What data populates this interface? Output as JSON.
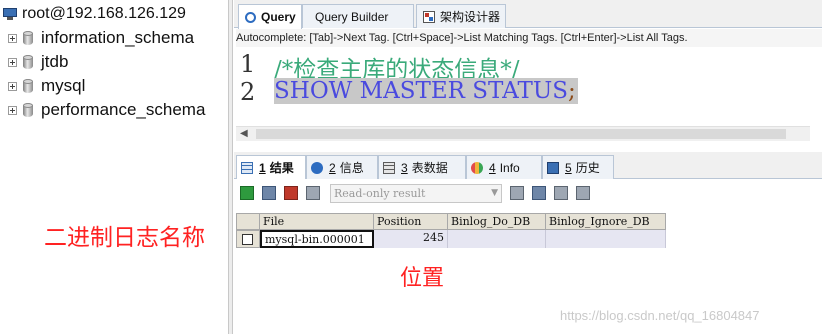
{
  "tree": {
    "root": "root@192.168.126.129",
    "databases": [
      "information_schema",
      "jtdb",
      "mysql",
      "performance_schema"
    ]
  },
  "query_tabs": [
    {
      "label": "Query",
      "icon": "search-icon",
      "active": true
    },
    {
      "label": "Query Builder",
      "icon": "query-builder-icon",
      "active": false
    },
    {
      "label": "架构设计器",
      "icon": "schema-designer-icon",
      "active": false
    }
  ],
  "autocomplete_hint": "Autocomplete: [Tab]->Next Tag. [Ctrl+Space]->List Matching Tags. [Ctrl+Enter]->List All Tags.",
  "editor": {
    "lines": [
      {
        "num": "1",
        "text": "/*检查主库的状态信息*/"
      },
      {
        "num": "2",
        "text": "SHOW MASTER STATUS",
        "suffix": ";"
      }
    ]
  },
  "result_tabs": [
    {
      "num": "1",
      "label": "结果",
      "icon": "results-icon",
      "active": true
    },
    {
      "num": "2",
      "label": "信息",
      "icon": "info-icon",
      "active": false
    },
    {
      "num": "3",
      "label": "表数据",
      "icon": "table-data-icon",
      "active": false
    },
    {
      "num": "4",
      "label": "Info",
      "icon": "info-chart-icon",
      "active": false
    },
    {
      "num": "5",
      "label": "历史",
      "icon": "history-icon",
      "active": false
    }
  ],
  "toolbar": {
    "mode": "Read-only result"
  },
  "grid": {
    "columns": [
      "File",
      "Position",
      "Binlog_Do_DB",
      "Binlog_Ignore_DB"
    ],
    "rows": [
      [
        "mysql-bin.000001",
        "245",
        "",
        ""
      ]
    ]
  },
  "annotations": {
    "binlog_name": "二进制日志名称",
    "position": "位置"
  },
  "watermark": "https://blog.csdn.net/qq_16804847",
  "colors": {
    "annotation": "#ff2222",
    "comment": "#3aaa7a",
    "keyword": "#4a4adf",
    "grid_row": "#e6e6f2"
  }
}
